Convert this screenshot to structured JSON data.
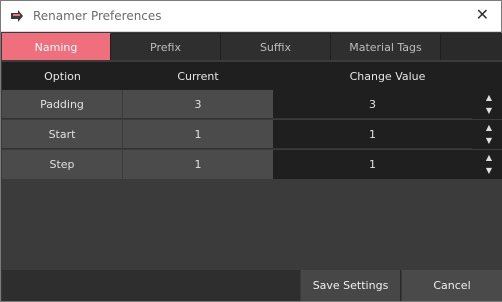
{
  "window": {
    "title": "Renamer Preferences",
    "close_glyph": "✕",
    "app_icon": "renamer-arrow-icon"
  },
  "tabs": [
    {
      "label": "Naming",
      "active": true
    },
    {
      "label": "Prefix",
      "active": false
    },
    {
      "label": "Suffix",
      "active": false
    },
    {
      "label": "Material Tags",
      "active": false
    }
  ],
  "table": {
    "headers": [
      "Option",
      "Current",
      "Change Value"
    ],
    "rows": [
      {
        "option": "Padding",
        "current": "3",
        "change": "3"
      },
      {
        "option": "Start",
        "current": "1",
        "change": "1"
      },
      {
        "option": "Step",
        "current": "1",
        "change": "1"
      }
    ]
  },
  "buttons": {
    "save": "Save Settings",
    "cancel": "Cancel"
  },
  "colors": {
    "accent": "#f06f7d",
    "panel": "#3b3b3b",
    "dark": "#1f1f1f",
    "cell": "#4b4b4b"
  }
}
